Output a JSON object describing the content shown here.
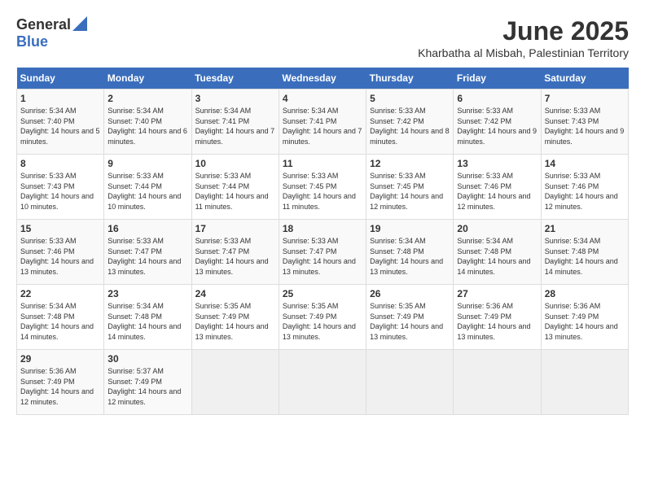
{
  "logo": {
    "general": "General",
    "blue": "Blue"
  },
  "title": "June 2025",
  "subtitle": "Kharbatha al Misbah, Palestinian Territory",
  "days_of_week": [
    "Sunday",
    "Monday",
    "Tuesday",
    "Wednesday",
    "Thursday",
    "Friday",
    "Saturday"
  ],
  "weeks": [
    [
      {
        "day": "1",
        "sunrise": "Sunrise: 5:34 AM",
        "sunset": "Sunset: 7:40 PM",
        "daylight": "Daylight: 14 hours and 5 minutes."
      },
      {
        "day": "2",
        "sunrise": "Sunrise: 5:34 AM",
        "sunset": "Sunset: 7:40 PM",
        "daylight": "Daylight: 14 hours and 6 minutes."
      },
      {
        "day": "3",
        "sunrise": "Sunrise: 5:34 AM",
        "sunset": "Sunset: 7:41 PM",
        "daylight": "Daylight: 14 hours and 7 minutes."
      },
      {
        "day": "4",
        "sunrise": "Sunrise: 5:34 AM",
        "sunset": "Sunset: 7:41 PM",
        "daylight": "Daylight: 14 hours and 7 minutes."
      },
      {
        "day": "5",
        "sunrise": "Sunrise: 5:33 AM",
        "sunset": "Sunset: 7:42 PM",
        "daylight": "Daylight: 14 hours and 8 minutes."
      },
      {
        "day": "6",
        "sunrise": "Sunrise: 5:33 AM",
        "sunset": "Sunset: 7:42 PM",
        "daylight": "Daylight: 14 hours and 9 minutes."
      },
      {
        "day": "7",
        "sunrise": "Sunrise: 5:33 AM",
        "sunset": "Sunset: 7:43 PM",
        "daylight": "Daylight: 14 hours and 9 minutes."
      }
    ],
    [
      {
        "day": "8",
        "sunrise": "Sunrise: 5:33 AM",
        "sunset": "Sunset: 7:43 PM",
        "daylight": "Daylight: 14 hours and 10 minutes."
      },
      {
        "day": "9",
        "sunrise": "Sunrise: 5:33 AM",
        "sunset": "Sunset: 7:44 PM",
        "daylight": "Daylight: 14 hours and 10 minutes."
      },
      {
        "day": "10",
        "sunrise": "Sunrise: 5:33 AM",
        "sunset": "Sunset: 7:44 PM",
        "daylight": "Daylight: 14 hours and 11 minutes."
      },
      {
        "day": "11",
        "sunrise": "Sunrise: 5:33 AM",
        "sunset": "Sunset: 7:45 PM",
        "daylight": "Daylight: 14 hours and 11 minutes."
      },
      {
        "day": "12",
        "sunrise": "Sunrise: 5:33 AM",
        "sunset": "Sunset: 7:45 PM",
        "daylight": "Daylight: 14 hours and 12 minutes."
      },
      {
        "day": "13",
        "sunrise": "Sunrise: 5:33 AM",
        "sunset": "Sunset: 7:46 PM",
        "daylight": "Daylight: 14 hours and 12 minutes."
      },
      {
        "day": "14",
        "sunrise": "Sunrise: 5:33 AM",
        "sunset": "Sunset: 7:46 PM",
        "daylight": "Daylight: 14 hours and 12 minutes."
      }
    ],
    [
      {
        "day": "15",
        "sunrise": "Sunrise: 5:33 AM",
        "sunset": "Sunset: 7:46 PM",
        "daylight": "Daylight: 14 hours and 13 minutes."
      },
      {
        "day": "16",
        "sunrise": "Sunrise: 5:33 AM",
        "sunset": "Sunset: 7:47 PM",
        "daylight": "Daylight: 14 hours and 13 minutes."
      },
      {
        "day": "17",
        "sunrise": "Sunrise: 5:33 AM",
        "sunset": "Sunset: 7:47 PM",
        "daylight": "Daylight: 14 hours and 13 minutes."
      },
      {
        "day": "18",
        "sunrise": "Sunrise: 5:33 AM",
        "sunset": "Sunset: 7:47 PM",
        "daylight": "Daylight: 14 hours and 13 minutes."
      },
      {
        "day": "19",
        "sunrise": "Sunrise: 5:34 AM",
        "sunset": "Sunset: 7:48 PM",
        "daylight": "Daylight: 14 hours and 13 minutes."
      },
      {
        "day": "20",
        "sunrise": "Sunrise: 5:34 AM",
        "sunset": "Sunset: 7:48 PM",
        "daylight": "Daylight: 14 hours and 14 minutes."
      },
      {
        "day": "21",
        "sunrise": "Sunrise: 5:34 AM",
        "sunset": "Sunset: 7:48 PM",
        "daylight": "Daylight: 14 hours and 14 minutes."
      }
    ],
    [
      {
        "day": "22",
        "sunrise": "Sunrise: 5:34 AM",
        "sunset": "Sunset: 7:48 PM",
        "daylight": "Daylight: 14 hours and 14 minutes."
      },
      {
        "day": "23",
        "sunrise": "Sunrise: 5:34 AM",
        "sunset": "Sunset: 7:48 PM",
        "daylight": "Daylight: 14 hours and 14 minutes."
      },
      {
        "day": "24",
        "sunrise": "Sunrise: 5:35 AM",
        "sunset": "Sunset: 7:49 PM",
        "daylight": "Daylight: 14 hours and 13 minutes."
      },
      {
        "day": "25",
        "sunrise": "Sunrise: 5:35 AM",
        "sunset": "Sunset: 7:49 PM",
        "daylight": "Daylight: 14 hours and 13 minutes."
      },
      {
        "day": "26",
        "sunrise": "Sunrise: 5:35 AM",
        "sunset": "Sunset: 7:49 PM",
        "daylight": "Daylight: 14 hours and 13 minutes."
      },
      {
        "day": "27",
        "sunrise": "Sunrise: 5:36 AM",
        "sunset": "Sunset: 7:49 PM",
        "daylight": "Daylight: 14 hours and 13 minutes."
      },
      {
        "day": "28",
        "sunrise": "Sunrise: 5:36 AM",
        "sunset": "Sunset: 7:49 PM",
        "daylight": "Daylight: 14 hours and 13 minutes."
      }
    ],
    [
      {
        "day": "29",
        "sunrise": "Sunrise: 5:36 AM",
        "sunset": "Sunset: 7:49 PM",
        "daylight": "Daylight: 14 hours and 12 minutes."
      },
      {
        "day": "30",
        "sunrise": "Sunrise: 5:37 AM",
        "sunset": "Sunset: 7:49 PM",
        "daylight": "Daylight: 14 hours and 12 minutes."
      },
      {
        "day": "",
        "sunrise": "",
        "sunset": "",
        "daylight": ""
      },
      {
        "day": "",
        "sunrise": "",
        "sunset": "",
        "daylight": ""
      },
      {
        "day": "",
        "sunrise": "",
        "sunset": "",
        "daylight": ""
      },
      {
        "day": "",
        "sunrise": "",
        "sunset": "",
        "daylight": ""
      },
      {
        "day": "",
        "sunrise": "",
        "sunset": "",
        "daylight": ""
      }
    ]
  ]
}
